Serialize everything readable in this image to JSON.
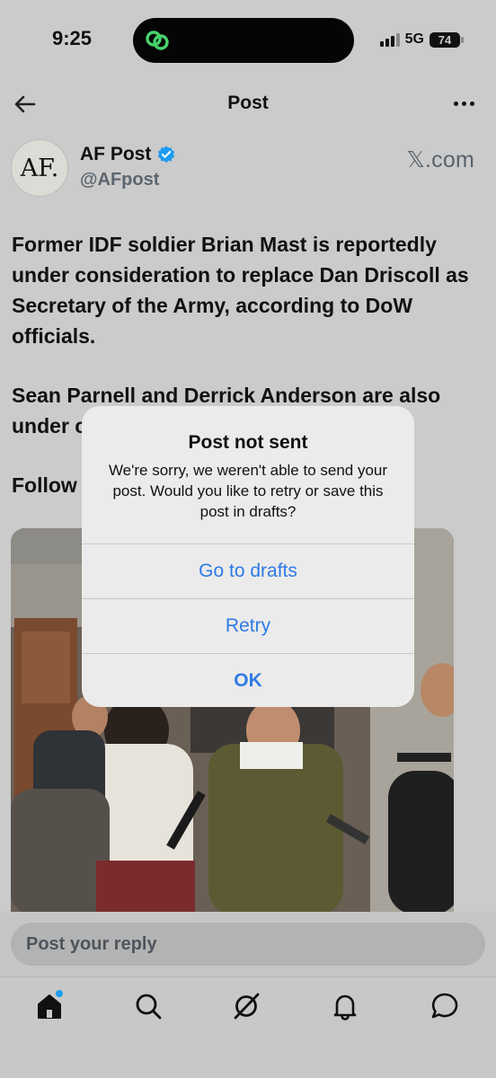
{
  "status_bar": {
    "time": "9:25",
    "network": "5G",
    "battery": "74"
  },
  "header": {
    "title": "Post"
  },
  "author": {
    "avatar_text": "AF.",
    "name": "AF Post",
    "handle": "@AFpost",
    "source": "𝕏.com"
  },
  "post": {
    "paragraph_1": "Former IDF soldier Brian Mast is reportedly under consideration to replace Dan Driscoll as Secretary of the Army, according to DoW officials.",
    "paragraph_2_visible": "Sean Parnell and Derrick Anderson are also under c",
    "paragraph_3_visible": "Follow"
  },
  "reply": {
    "placeholder": "Post your reply"
  },
  "alert": {
    "title": "Post not sent",
    "message": "We're sorry, we weren't able to send your post. Would you like to retry or save this post in drafts?",
    "buttons": {
      "drafts": "Go to drafts",
      "retry": "Retry",
      "ok": "OK"
    }
  },
  "tabs": [
    {
      "icon": "home-icon"
    },
    {
      "icon": "search-icon"
    },
    {
      "icon": "grok-icon"
    },
    {
      "icon": "bell-icon"
    },
    {
      "icon": "message-icon"
    }
  ],
  "colors": {
    "accent": "#2f7ae5",
    "verified": "#1d9bf0",
    "dim_background": "#cbcbcb",
    "alert_background": "#ebebeb"
  }
}
